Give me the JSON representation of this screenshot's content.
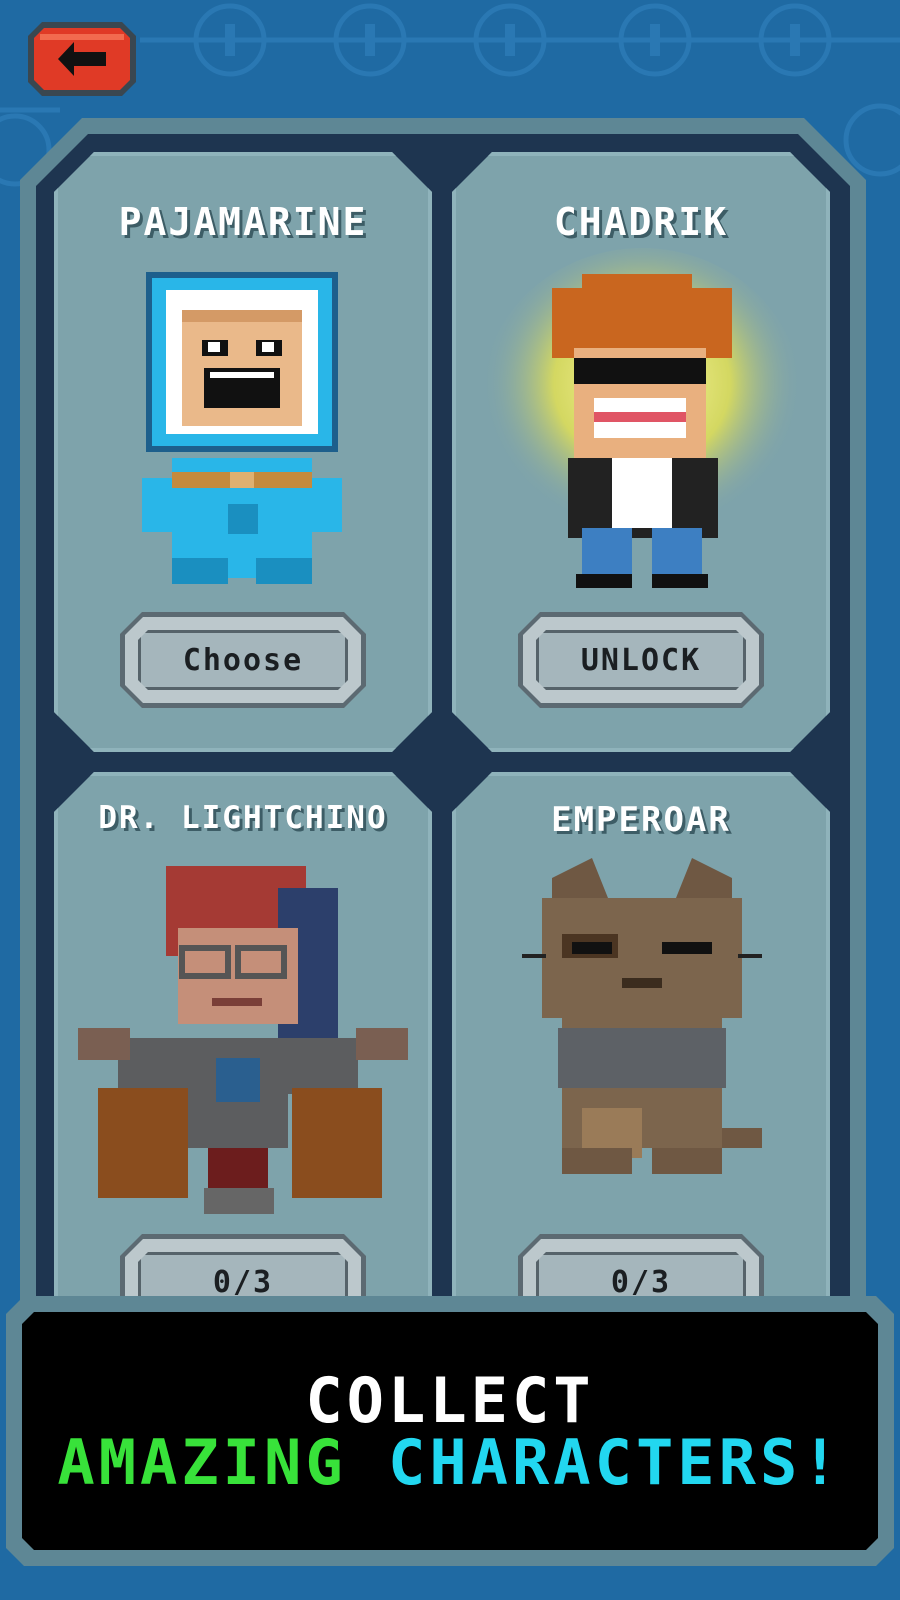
{
  "header": {
    "back_icon": "arrow-left-icon"
  },
  "characters": [
    {
      "name": "PAJAMARINE",
      "button_label": "Choose"
    },
    {
      "name": "CHADRIK",
      "button_label": "UNLOCK"
    },
    {
      "name": "DR. LIGHTCHINO",
      "button_label": "0/3"
    },
    {
      "name": "EMPEROAR",
      "button_label": "0/3"
    }
  ],
  "banner": {
    "line1": "COLLECT",
    "line2_word1": "AMAZING",
    "line2_word2": "CHARACTERS!"
  },
  "colors": {
    "background": "#1f6aa3",
    "back_button": "#e03a26",
    "banner_green": "#38e23a",
    "banner_cyan": "#22d7f0"
  }
}
